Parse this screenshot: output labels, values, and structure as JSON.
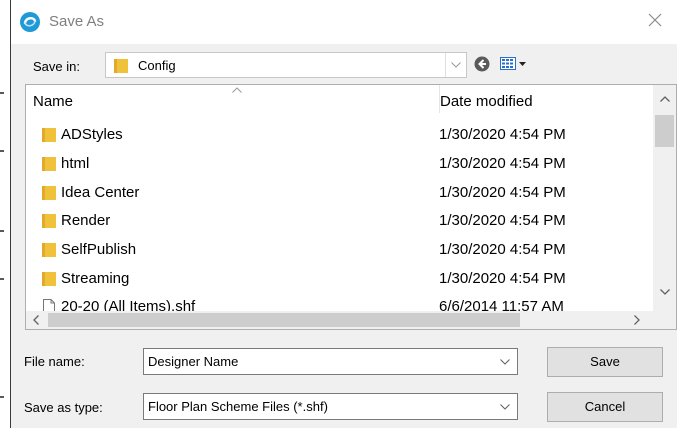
{
  "dialog": {
    "title": "Save As"
  },
  "toolbar": {
    "save_in_label": "Save in:",
    "save_in_value": "Config"
  },
  "list": {
    "columns": [
      "Name",
      "Date modified"
    ],
    "rows": [
      {
        "name": "ADStyles",
        "date": "1/30/2020 4:54 PM",
        "type": "folder"
      },
      {
        "name": "html",
        "date": "1/30/2020 4:54 PM",
        "type": "folder"
      },
      {
        "name": "Idea Center",
        "date": "1/30/2020 4:54 PM",
        "type": "folder"
      },
      {
        "name": "Render",
        "date": "1/30/2020 4:54 PM",
        "type": "folder"
      },
      {
        "name": "SelfPublish",
        "date": "1/30/2020 4:54 PM",
        "type": "folder"
      },
      {
        "name": "Streaming",
        "date": "1/30/2020 4:54 PM",
        "type": "folder"
      },
      {
        "name": "20-20 (All Items).shf",
        "date": "6/6/2014 11:57 AM",
        "type": "file"
      }
    ]
  },
  "form": {
    "file_name_label": "File name:",
    "file_name_value": "Designer Name",
    "save_type_label": "Save as type:",
    "save_type_value": "Floor Plan Scheme Files (*.shf)"
  },
  "buttons": {
    "save": "Save",
    "cancel": "Cancel"
  },
  "colors": {
    "folder": "#f0c23b",
    "accent": "#1f9ad6"
  }
}
